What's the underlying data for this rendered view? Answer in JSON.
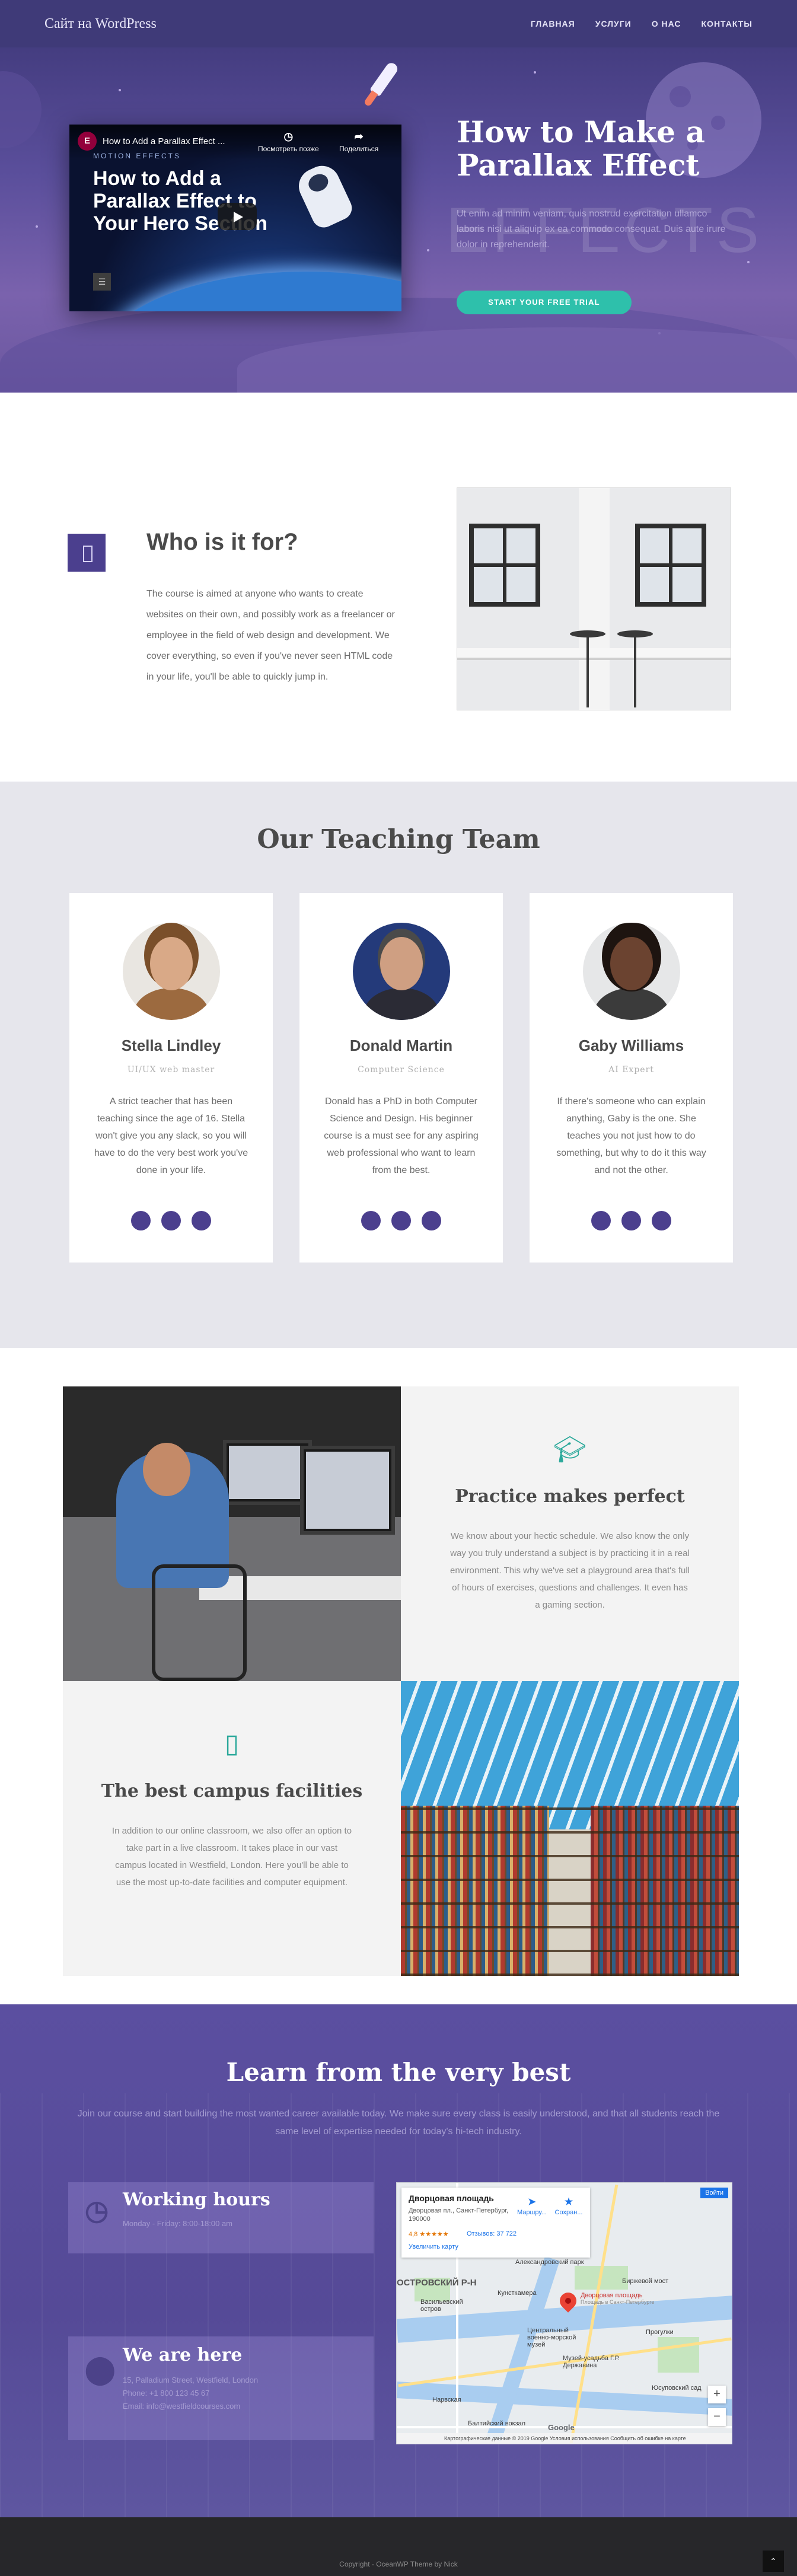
{
  "header": {
    "site_title": "Сайт на WordPress",
    "nav": [
      "ГЛАВНАЯ",
      "УСЛУГИ",
      "О НАС",
      "КОНТАКТЫ"
    ]
  },
  "hero": {
    "video": {
      "title": "How to Add a Parallax Effect ...",
      "watch_later": "Посмотреть позже",
      "share": "Поделиться",
      "subtitle": "MOTION EFFECTS",
      "overlay_text": "How to Add a Parallax Effect to Your Hero Section"
    },
    "title": "How to Make a Parallax Effect",
    "bg_word": "EFFECTS",
    "description": "Ut enim ad minim veniam, quis nostrud exercitation ullamco laboris nisi ut aliquip ex ea commodo consequat. Duis aute irure dolor in reprehenderit.",
    "cta": "START YOUR FREE TRIAL"
  },
  "who": {
    "title": "Who is it for?",
    "text": "The course is aimed at anyone who wants to create websites on their own, and possibly work as a freelancer or employee in the field of web design and development. We cover everything, so even if you've never seen HTML code in your life, you'll be able to quickly jump in."
  },
  "team": {
    "title": "Our Teaching Team",
    "members": [
      {
        "name": "Stella Lindley",
        "role": "UI/UX web master",
        "bio": "A strict teacher that has been teaching since the age of 16. Stella won't give you any slack, so you will have to do the very best work you've done in your life."
      },
      {
        "name": "Donald Martin",
        "role": "Computer Science",
        "bio": "Donald has a PhD in both Computer Science and Design. His beginner course is a must see for any aspiring web professional who want to learn from the best."
      },
      {
        "name": "Gaby Williams",
        "role": "AI Expert",
        "bio": "If there's someone who can explain anything, Gaby is the one. She teaches you not just how to do something, but why to do it this way and not the other."
      }
    ]
  },
  "features": {
    "practice": {
      "title": "Practice makes perfect",
      "text": "We know about your hectic schedule. We also know the only way you truly understand a subject is by practicing it in a real environment. This why we've set a playground area that's full of hours of exercises, questions and challenges. It even has a gaming section."
    },
    "campus": {
      "title": "The best campus facilities",
      "text": "In addition to our online classroom, we also offer an option to take part in a live classroom. It takes place in our vast campus located in Westfield, London. Here you'll be able to use the most up-to-date facilities and computer equipment."
    }
  },
  "learn": {
    "title": "Learn from the very best",
    "subtitle": "Join our course and start building the most wanted career available today. We make sure every class is easily understood, and that all students reach the same level of expertise needed for today's hi-tech industry.",
    "hours": {
      "title": "Working hours",
      "line": "Monday - Friday: 8:00-18:00 am"
    },
    "location": {
      "title": "We are here",
      "lines": [
        "15, Palladium Street, Westfield, London",
        "Phone: +1 800 123 45 67",
        "Email: info@westfieldcourses.com"
      ]
    }
  },
  "map": {
    "place": "Дворцовая площадь",
    "address": "Дворцовая пл., Санкт-Петербург, 190000",
    "rating": "4,8 ★★★★★",
    "reviews": "Отзывов: 37 722",
    "bigger_map": "Увеличить карту",
    "directions": "Маршру...",
    "save": "Сохран...",
    "sign_in": "Войти",
    "district": "ОСТРОВСКИЙ Р-Н",
    "pin_label": "Дворцовая площадь",
    "pin_sub": "Площадь в Санкт-Петербурге",
    "labels": [
      "Александровский парк",
      "Васильевский остров",
      "Кунсткамера",
      "Центральный военно-морской музей",
      "Прогулки",
      "Музей-усадьба Г.Р. Державина",
      "Юсуповский сад",
      "Балтийский вокзал",
      "Нарвская",
      "Биржевой мост"
    ],
    "footer": "Картографические данные © 2019 Google   Условия использования   Сообщить об ошибке на карте",
    "google": "Google"
  },
  "footer": {
    "copyright": "Copyright - OceanWP Theme by Nick",
    "to_top": "⌃"
  }
}
